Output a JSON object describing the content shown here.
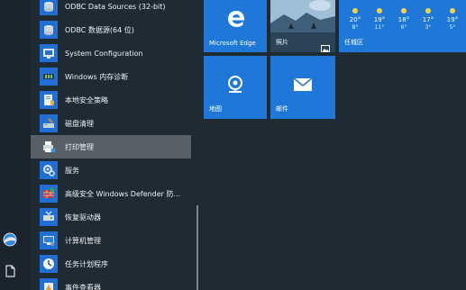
{
  "menu": {
    "items": [
      {
        "label": "ODBC Data Sources (32-bit)",
        "icon": "odbc-icon"
      },
      {
        "label": "ODBC 数据源(64 位)",
        "icon": "odbc-icon"
      },
      {
        "label": "System Configuration",
        "icon": "system-config-icon"
      },
      {
        "label": "Windows 内存诊断",
        "icon": "memory-diagnostic-icon"
      },
      {
        "label": "本地安全策略",
        "icon": "security-policy-icon"
      },
      {
        "label": "磁盘清理",
        "icon": "disk-cleanup-icon"
      },
      {
        "label": "打印管理",
        "icon": "print-management-icon",
        "highlighted": true
      },
      {
        "label": "服务",
        "icon": "services-icon"
      },
      {
        "label": "高级安全 Windows Defender 防...",
        "icon": "firewall-icon"
      },
      {
        "label": "恢复驱动器",
        "icon": "recovery-drive-icon"
      },
      {
        "label": "计算机管理",
        "icon": "computer-management-icon"
      },
      {
        "label": "任务计划程序",
        "icon": "task-scheduler-icon"
      },
      {
        "label": "事件查看器",
        "icon": "event-viewer-icon"
      }
    ]
  },
  "leftbar": {
    "icons": [
      "user-avatar-icon",
      "document-icon"
    ]
  },
  "tiles": {
    "edge": {
      "label": "Microsoft Edge",
      "icon": "edge-icon"
    },
    "photos": {
      "label": "照片",
      "icon": "photos-icon"
    },
    "weather": {
      "location": "任城区",
      "days": [
        {
          "hi": "20°",
          "lo": "8°"
        },
        {
          "hi": "19°",
          "lo": "11°"
        },
        {
          "hi": "18°",
          "lo": "6°"
        },
        {
          "hi": "17°",
          "lo": "3°"
        },
        {
          "hi": "19°",
          "lo": "5°"
        }
      ]
    },
    "maps": {
      "label": "地图",
      "icon": "maps-icon"
    },
    "mail": {
      "label": "邮件",
      "icon": "mail-icon"
    }
  },
  "colors": {
    "accent": "#1f78d8",
    "menu_bg": "#1f2a33",
    "highlight": "#585f65"
  }
}
